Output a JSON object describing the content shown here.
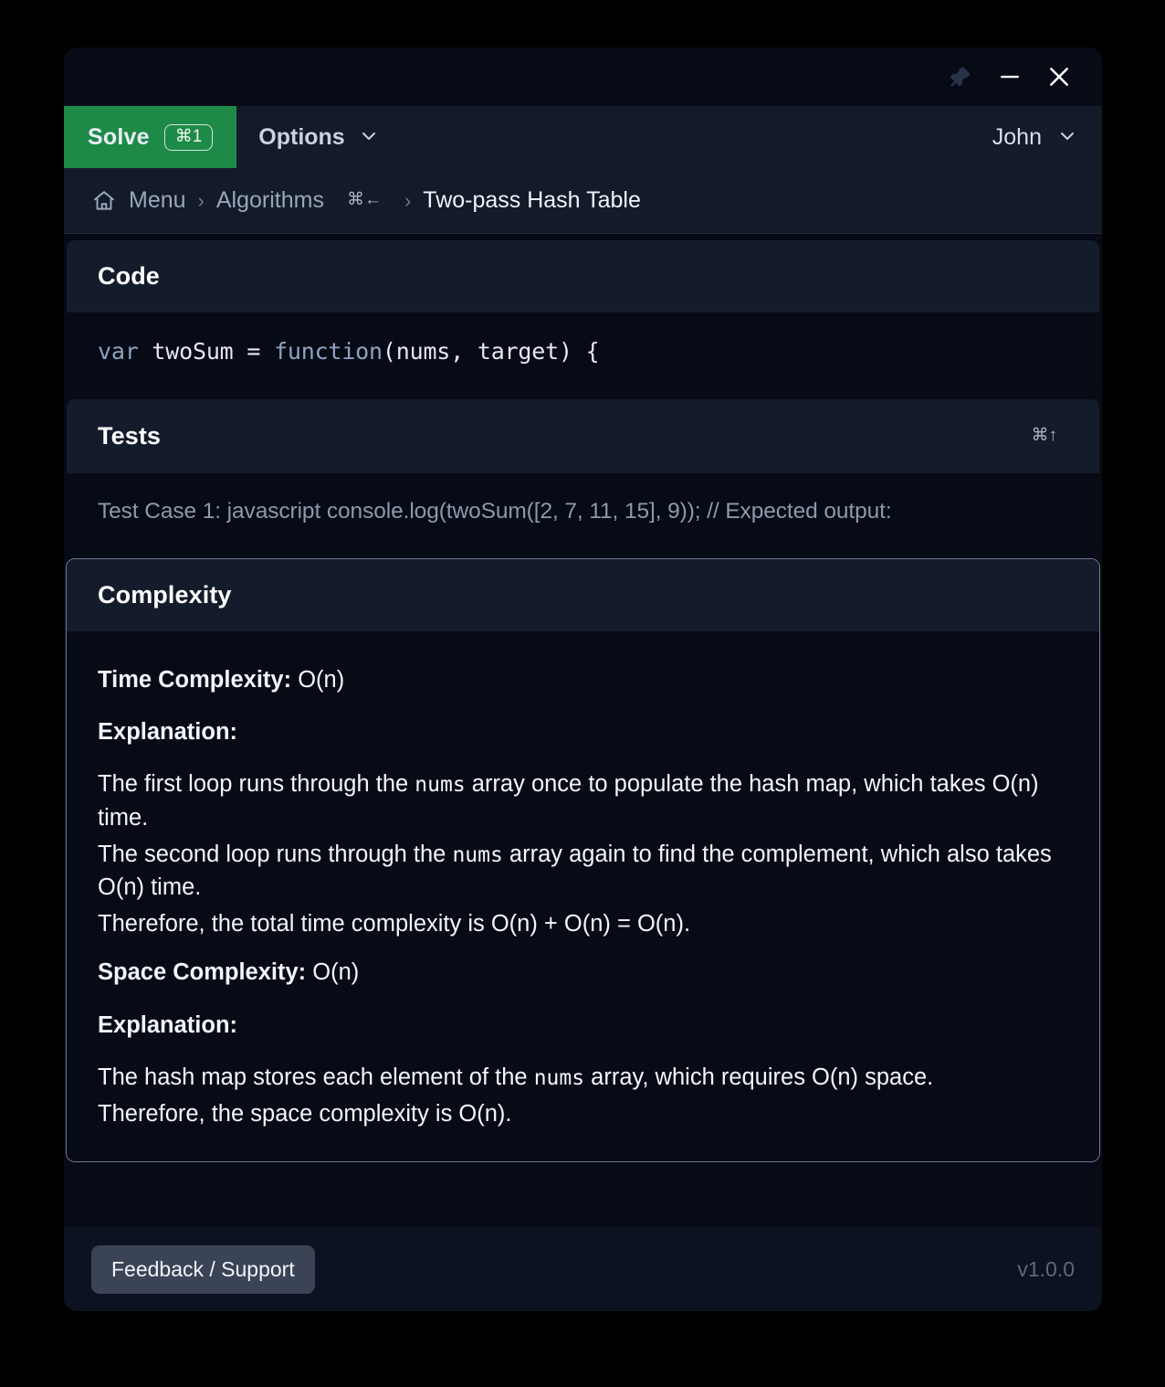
{
  "window": {
    "controls": [
      {
        "name": "pin",
        "glyph": "pin-icon",
        "state": "inactive"
      },
      {
        "name": "minimize",
        "glyph": "minimize-icon",
        "state": "active"
      },
      {
        "name": "close",
        "glyph": "close-icon",
        "state": "active"
      }
    ]
  },
  "toolbar": {
    "solve_label": "Solve",
    "solve_shortcut": "⌘1",
    "options_label": "Options",
    "user_label": "John",
    "accent_green": "#1e8a47"
  },
  "breadcrumb": {
    "home_icon": "home-icon",
    "items": [
      {
        "label": "Menu",
        "current": false
      },
      {
        "label": "Algorithms",
        "current": false
      },
      {
        "label": "Two-pass Hash Table",
        "current": true
      }
    ],
    "shortcut": "⌘←",
    "separator": "›"
  },
  "sections": {
    "code": {
      "title": "Code",
      "line_kw1": "var",
      "line_mid": " twoSum = ",
      "line_kw2": "function",
      "line_rest": "(nums, target) {"
    },
    "tests": {
      "title": "Tests",
      "shortcut": "⌘↑",
      "case_text": "Test Case 1: javascript console.log(twoSum([2, 7, 11, 15], 9)); // Expected output:"
    },
    "complexity": {
      "title": "Complexity",
      "time_label": "Time Complexity:",
      "time_value": "O(n)",
      "time_explanation_label": "Explanation:",
      "time_para_1a": "The first loop runs through the ",
      "time_para_1_code": "nums",
      "time_para_1b": " array once to populate the hash map, which takes O(n) time.",
      "time_para_2a": "The second loop runs through the ",
      "time_para_2_code": "nums",
      "time_para_2b": " array again to find the complement, which also takes O(n) time.",
      "time_para_3": "Therefore, the total time complexity is O(n) + O(n) = O(n).",
      "space_label": "Space Complexity:",
      "space_value": "O(n)",
      "space_explanation_label": "Explanation:",
      "space_para_1a": "The hash map stores each element of the ",
      "space_para_1_code": "nums",
      "space_para_1b": " array, which requires O(n) space.",
      "space_para_2": "Therefore, the space complexity is O(n)."
    }
  },
  "footer": {
    "feedback_label": "Feedback / Support",
    "version": "v1.0.0"
  }
}
